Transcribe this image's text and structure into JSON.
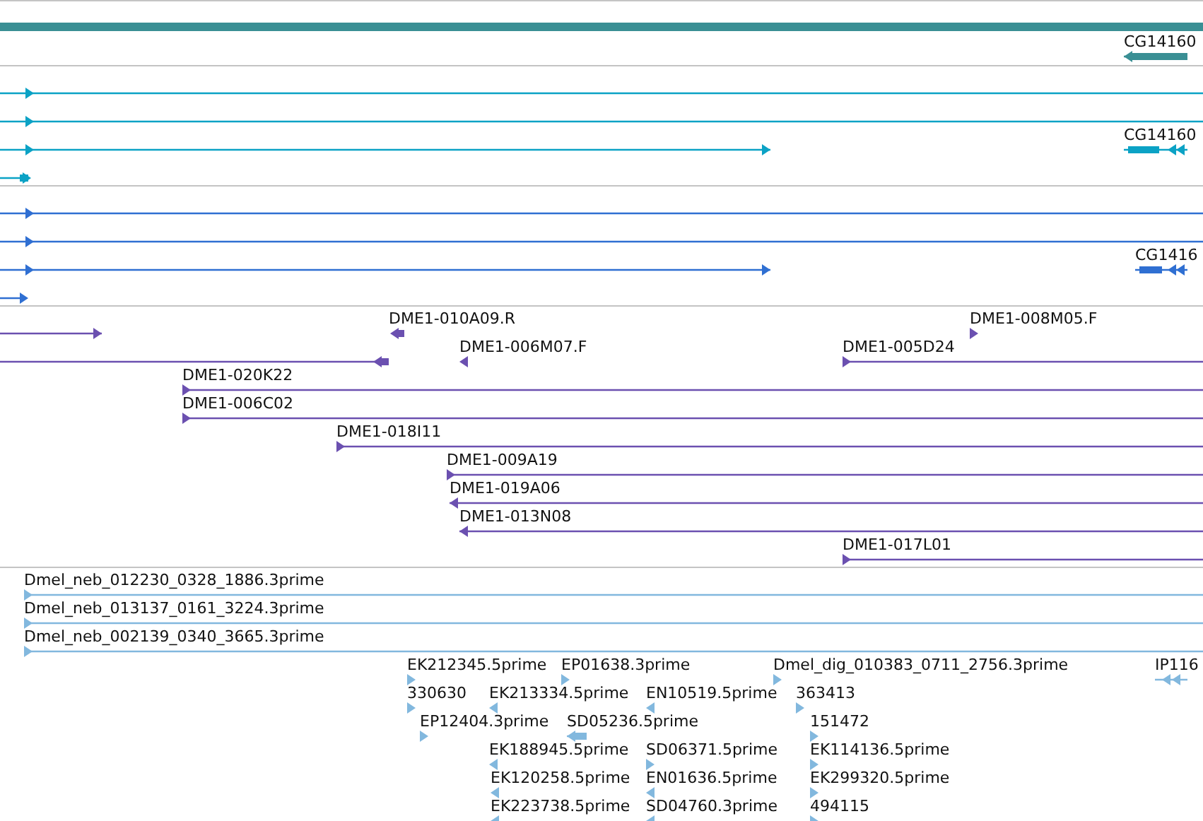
{
  "tracks": [
    {
      "kind": "summary",
      "color": "#3a8f94",
      "features": [
        {
          "label": "CG14160",
          "reverse": true
        }
      ]
    },
    {
      "kind": "transcripts",
      "color": "#0ba2c5",
      "features": [
        {
          "reverse": false
        },
        {
          "reverse": false
        },
        {
          "reverse": false
        },
        {
          "reverse": false
        },
        {
          "label": "CG14160",
          "reverse": true
        }
      ]
    },
    {
      "kind": "transcripts",
      "color": "#2f6fd2",
      "features": [
        {
          "reverse": false
        },
        {
          "reverse": false
        },
        {
          "reverse": false
        },
        {
          "reverse": false
        },
        {
          "label": "CG1416",
          "reverse": true
        }
      ]
    },
    {
      "kind": "transcripts",
      "color": "#6b50b0",
      "features": [
        {
          "reverse": false
        },
        {
          "label": "DME1-010A09.R",
          "reverse": true
        },
        {
          "label": "DME1-008M05.F",
          "reverse": false
        },
        {
          "reverse": true
        },
        {
          "label": "DME1-006M07.F",
          "reverse": true
        },
        {
          "label": "DME1-005D24",
          "reverse": false
        },
        {
          "label": "DME1-020K22",
          "reverse": false
        },
        {
          "label": "DME1-006C02",
          "reverse": false
        },
        {
          "label": "DME1-018I11",
          "reverse": false
        },
        {
          "label": "DME1-009A19",
          "reverse": false
        },
        {
          "label": "DME1-019A06",
          "reverse": true
        },
        {
          "label": "DME1-013N08",
          "reverse": true
        },
        {
          "label": "DME1-017L01",
          "reverse": false
        }
      ]
    },
    {
      "kind": "transcripts",
      "color": "#82b8de",
      "features": [
        {
          "label": "Dmel_neb_012230_0328_1886.3prime",
          "reverse": false
        },
        {
          "label": "Dmel_neb_013137_0161_3224.3prime",
          "reverse": false
        },
        {
          "label": "Dmel_neb_002139_0340_3665.3prime",
          "reverse": false
        },
        {
          "label": "EK212345.5prime",
          "reverse": false
        },
        {
          "label": "EP01638.3prime",
          "reverse": false
        },
        {
          "label": "Dmel_dig_010383_0711_2756.3prime",
          "reverse": false
        },
        {
          "label": "IP116",
          "reverse": true
        },
        {
          "label": "330630",
          "reverse": false
        },
        {
          "label": "EK213334.5prime",
          "reverse": true
        },
        {
          "label": "EN10519.5prime",
          "reverse": true
        },
        {
          "label": "363413",
          "reverse": false
        },
        {
          "label": "EP12404.3prime",
          "reverse": false
        },
        {
          "label": "SD05236.5prime",
          "reverse": true
        },
        {
          "label": "151472",
          "reverse": false
        },
        {
          "label": "EK188945.5prime",
          "reverse": true
        },
        {
          "label": "SD06371.5prime",
          "reverse": false
        },
        {
          "label": "EK114136.5prime",
          "reverse": false
        },
        {
          "label": "EK120258.5prime",
          "reverse": true
        },
        {
          "label": "EN01636.5prime",
          "reverse": true
        },
        {
          "label": "EK299320.5prime",
          "reverse": false
        },
        {
          "label": "EK223738.5prime",
          "reverse": true
        },
        {
          "label": "SD04760.3prime",
          "reverse": true
        },
        {
          "label": "494115",
          "reverse": false
        }
      ]
    }
  ]
}
